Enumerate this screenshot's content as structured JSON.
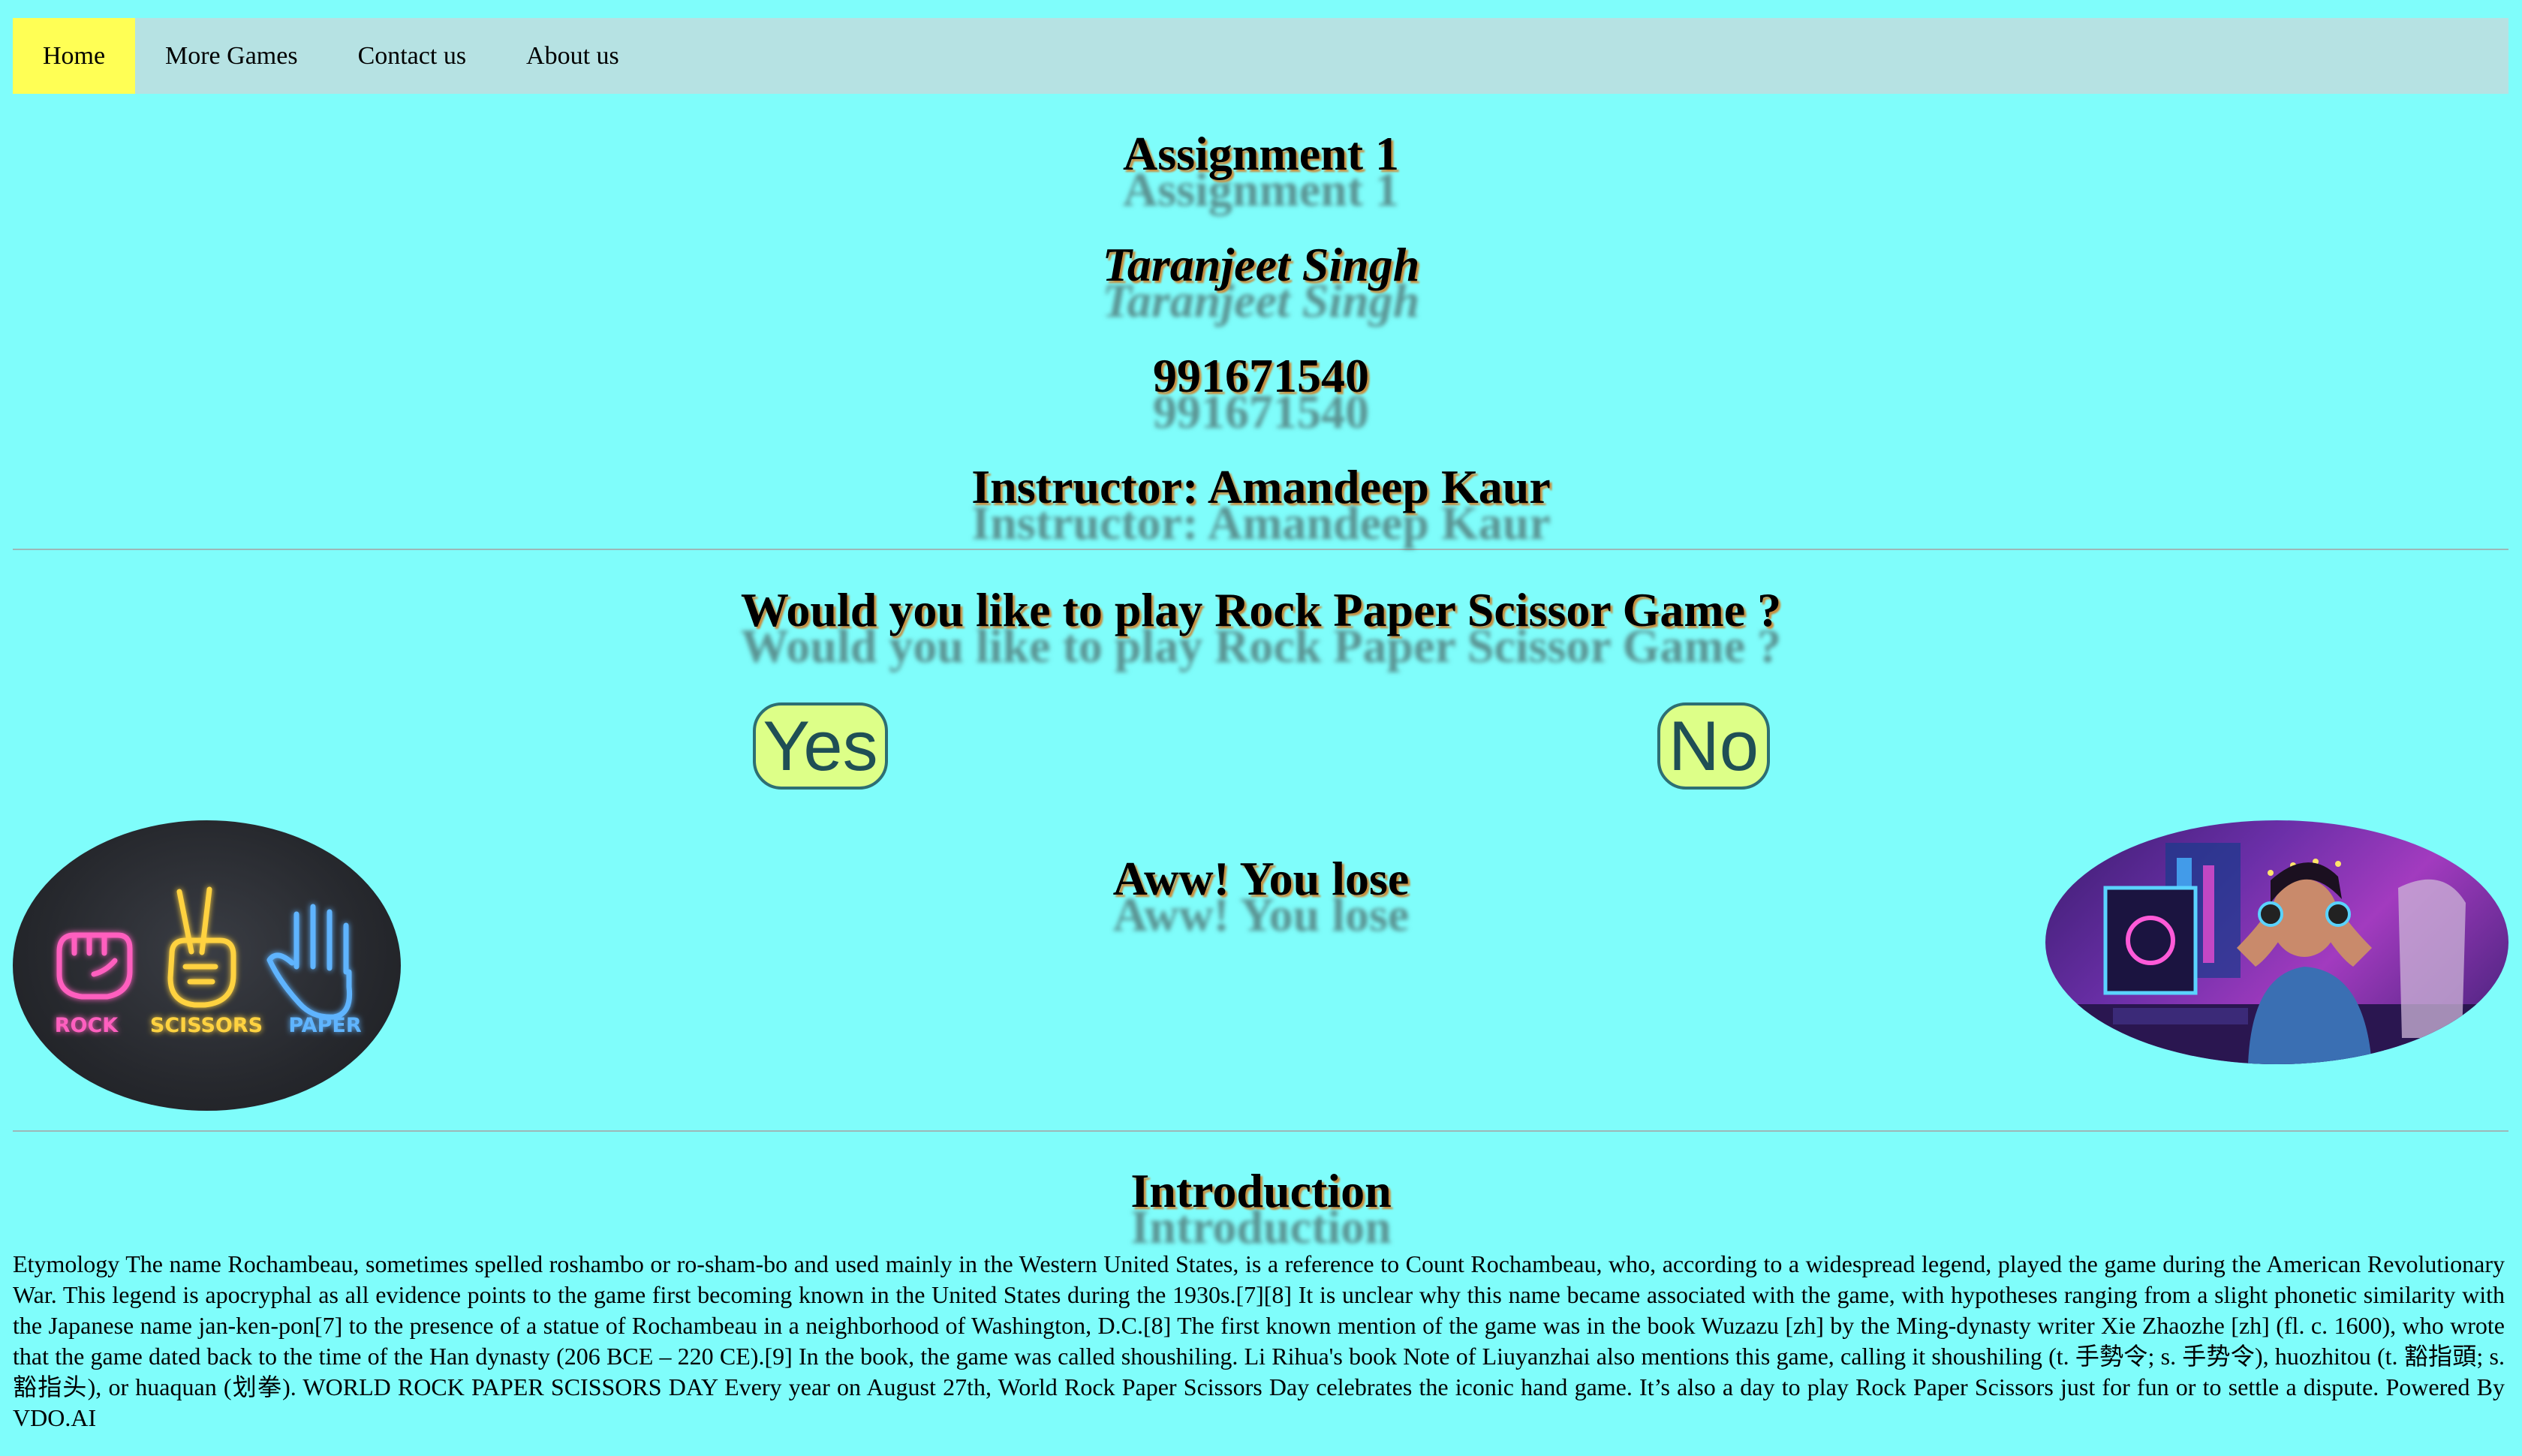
{
  "nav": {
    "items": [
      {
        "label": "Home",
        "active": true
      },
      {
        "label": "More Games",
        "active": false
      },
      {
        "label": "Contact us",
        "active": false
      },
      {
        "label": "About us",
        "active": false
      }
    ]
  },
  "header": {
    "assignment": "Assignment 1",
    "name": "Taranjeet Singh",
    "student_id": "991671540",
    "instructor": "Instructor: Amandeep Kaur"
  },
  "game": {
    "question": "Would you like to play Rock Paper Scissor Game ?",
    "yes_label": "Yes",
    "no_label": "No",
    "result": "Aww! You lose",
    "left_image": {
      "icons": [
        "fist-icon",
        "peace-hand-icon",
        "open-hand-icon"
      ],
      "labels": [
        "ROCK",
        "SCISSORS",
        "PAPER"
      ]
    },
    "right_image": {
      "description_icon": "frustrated-gamer-icon"
    }
  },
  "intro": {
    "title": "Introduction",
    "body": "Etymology The name Rochambeau, sometimes spelled roshambo or ro-sham-bo and used mainly in the Western United States, is a reference to Count Rochambeau, who, according to a widespread legend, played the game during the American Revolutionary War. This legend is apocryphal as all evidence points to the game first becoming known in the United States during the 1930s.[7][8] It is unclear why this name became associated with the game, with hypotheses ranging from a slight phonetic similarity with the Japanese name jan-ken-pon[7] to the presence of a statue of Rochambeau in a neighborhood of Washington, D.C.[8] The first known mention of the game was in the book Wuzazu [zh] by the Ming-dynasty writer Xie Zhaozhe [zh] (fl. c. 1600), who wrote that the game dated back to the time of the Han dynasty (206 BCE – 220 CE).[9] In the book, the game was called shoushiling. Li Rihua's book Note of Liuyanzhai also mentions this game, calling it shoushiling (t. 手勢令; s. 手势令), huozhitou (t. 豁指頭; s. 豁指头), or huaquan (划拳). WORLD ROCK PAPER SCISSORS DAY Every year on August 27th, World Rock Paper Scissors Day celebrates the iconic hand game. It’s also a day to play Rock Paper Scissors just for fun or to settle a dispute. Powered By VDO.AI"
  },
  "colors": {
    "background": "#7ffdfb",
    "nav_background": "#b6e2e3",
    "nav_active": "#ffff55",
    "button_fill": "#ddff88",
    "button_border": "#2d6f73",
    "heading_shadow": "#c98d3d",
    "rock": "#ff5fbf",
    "scissors": "#ffd23f",
    "paper": "#5fb4ff"
  }
}
